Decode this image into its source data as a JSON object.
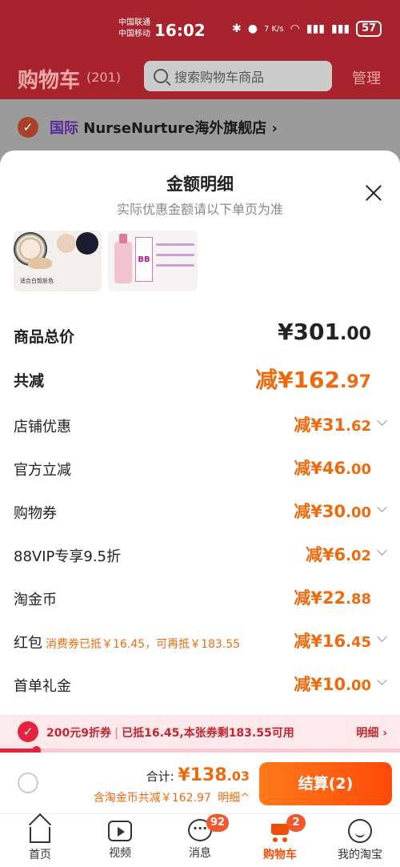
{
  "status_bar": {
    "carrier_1": "中国联通",
    "carrier_2": "中国移动",
    "time": "16:02",
    "net_speed": "7 K/s",
    "battery": "57"
  },
  "header": {
    "title": "购物车",
    "count": "(201)",
    "search_placeholder": "搜索购物车商品",
    "manage": "管理"
  },
  "store": {
    "badge": "国际",
    "name": "NurseNurture海外旗舰店",
    "chevron": "›"
  },
  "sheet": {
    "title": "金额明细",
    "subtitle": "实际优惠金额请以下单页为准",
    "thumb1_caption": "适合白皙肤色",
    "thumb2_label": "BB",
    "rows": [
      {
        "label": "商品总价",
        "int": "¥301",
        "dec": ".00",
        "note": ""
      },
      {
        "label": "共减",
        "int": "减¥162",
        "dec": ".97",
        "note": ""
      },
      {
        "label": "店铺优惠",
        "int": "减¥31",
        "dec": ".62",
        "note": ""
      },
      {
        "label": "官方立减",
        "int": "减¥46",
        "dec": ".00",
        "note": ""
      },
      {
        "label": "购物券",
        "int": "减¥30",
        "dec": ".00",
        "note": ""
      },
      {
        "label": "88VIP专享9.5折",
        "int": "减¥6",
        "dec": ".02",
        "note": ""
      },
      {
        "label": "淘金币",
        "int": "减¥22",
        "dec": ".88",
        "note": ""
      },
      {
        "label": "红包",
        "int": "减¥16",
        "dec": ".45",
        "note": "消费券已抵￥16.45，可再抵￥183.55"
      },
      {
        "label": "首单礼金",
        "int": "减¥10",
        "dec": ".00",
        "note": ""
      }
    ]
  },
  "coupon": {
    "name": "200元9折券",
    "status": "已抵16.45,本张券剩183.55可用",
    "detail": "明细",
    "progress": 0.09
  },
  "checkout": {
    "total_label": "合计:",
    "total_int": "¥138",
    "total_dec": ".03",
    "saved": "含淘金币共减￥162.97",
    "detail": "明细^",
    "button": "结算(2)"
  },
  "tabbar": {
    "tabs": [
      {
        "label": "首页",
        "badge": ""
      },
      {
        "label": "视频",
        "badge": ""
      },
      {
        "label": "消息",
        "badge": "92"
      },
      {
        "label": "购物车",
        "badge": "2"
      },
      {
        "label": "我的淘宝",
        "badge": ""
      }
    ]
  },
  "colors": {
    "accent": "#ee6a0e",
    "header_bg": "#a8232d",
    "coupon_red": "#e6233f"
  }
}
